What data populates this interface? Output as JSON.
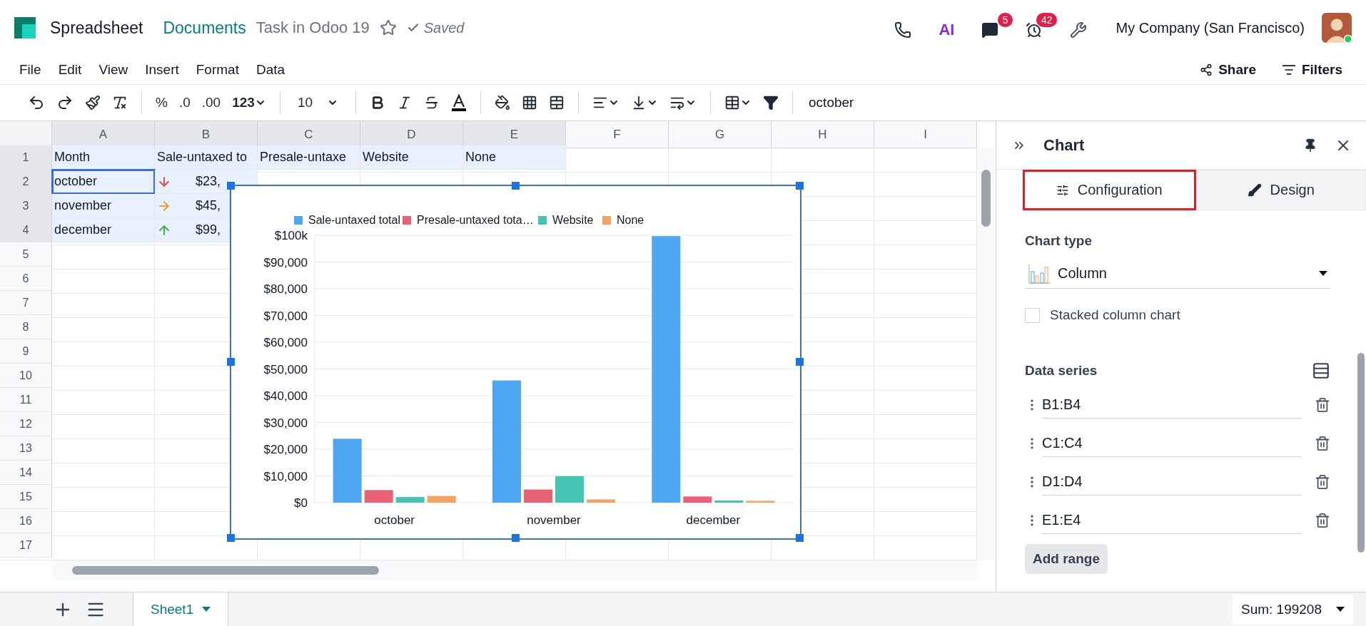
{
  "app": {
    "title": "Spreadsheet",
    "breadcrumb": "Documents",
    "record": "Task in Odoo 19",
    "status": "Saved"
  },
  "systray": {
    "ai": "AI",
    "chat_badge": "5",
    "activity_badge": "42",
    "company": "My Company (San Francisco)"
  },
  "menu": [
    "File",
    "Edit",
    "View",
    "Insert",
    "Format",
    "Data"
  ],
  "actions": [
    "Share",
    "Filters"
  ],
  "toolbar": {
    "formats": [
      "%",
      ".0",
      ".00",
      "123"
    ],
    "font_size": "10",
    "formula": "october"
  },
  "grid": {
    "columns": [
      {
        "label": "A",
        "selected": true
      },
      {
        "label": "B",
        "selected": true
      },
      {
        "label": "C",
        "selected": true
      },
      {
        "label": "D",
        "selected": true
      },
      {
        "label": "E",
        "selected": true
      },
      {
        "label": "F",
        "selected": false
      },
      {
        "label": "G",
        "selected": false
      },
      {
        "label": "H",
        "selected": false
      },
      {
        "label": "I",
        "selected": false
      }
    ],
    "rows": [
      {
        "label": "1",
        "selected": true,
        "cells": [
          {
            "text": "Month",
            "selected": true,
            "active": false
          },
          {
            "text": "Sale-untaxed to",
            "selected": true,
            "active": false
          },
          {
            "text": "Presale-untaxe",
            "selected": true,
            "active": false
          },
          {
            "text": "Website",
            "selected": true,
            "active": false
          },
          {
            "text": "None",
            "selected": true,
            "active": false
          }
        ]
      },
      {
        "label": "2",
        "selected": true,
        "cells": [
          {
            "text": "october",
            "selected": true,
            "active": true
          },
          {
            "text": "$23,",
            "kind": "down",
            "selected": true,
            "active": false
          }
        ]
      },
      {
        "label": "3",
        "selected": true,
        "cells": [
          {
            "text": "november",
            "selected": true,
            "active": false
          },
          {
            "text": "$45,",
            "kind": "flat",
            "selected": true,
            "active": false
          }
        ]
      },
      {
        "label": "4",
        "selected": true,
        "cells": [
          {
            "text": "december",
            "selected": true,
            "active": false
          },
          {
            "text": "$99,",
            "kind": "up",
            "selected": true,
            "active": false
          }
        ]
      },
      {
        "label": "5",
        "selected": false,
        "cells": []
      },
      {
        "label": "6",
        "selected": false,
        "cells": []
      },
      {
        "label": "7",
        "selected": false,
        "cells": []
      },
      {
        "label": "8",
        "selected": false,
        "cells": []
      },
      {
        "label": "9",
        "selected": false,
        "cells": []
      },
      {
        "label": "10",
        "selected": false,
        "cells": []
      },
      {
        "label": "11",
        "selected": false,
        "cells": []
      },
      {
        "label": "12",
        "selected": false,
        "cells": []
      },
      {
        "label": "13",
        "selected": false,
        "cells": []
      },
      {
        "label": "14",
        "selected": false,
        "cells": []
      },
      {
        "label": "15",
        "selected": false,
        "cells": []
      },
      {
        "label": "16",
        "selected": false,
        "cells": []
      },
      {
        "label": "17",
        "selected": false,
        "cells": []
      }
    ]
  },
  "chart": {
    "chart_data": {
      "type": "bar",
      "grid": true,
      "legend": "top",
      "categories": [
        "october",
        "november",
        "december"
      ],
      "series": [
        {
          "name": "Sale-untaxed total",
          "color": "#4ea7f2",
          "values": [
            23900,
            45700,
            99700
          ]
        },
        {
          "name": "Presale-untaxed tota…",
          "color": "#ea6175",
          "values": [
            4700,
            4900,
            2300
          ]
        },
        {
          "name": "Website",
          "color": "#43c5b1",
          "values": [
            2100,
            9900,
            800
          ]
        },
        {
          "name": "None",
          "color": "#f4a261",
          "values": [
            2500,
            1200,
            700
          ]
        }
      ],
      "ylim": [
        0,
        100000
      ],
      "yticks": [
        {
          "value": 0,
          "label": "$0"
        },
        {
          "value": 10000,
          "label": "$10,000"
        },
        {
          "value": 20000,
          "label": "$20,000"
        },
        {
          "value": 30000,
          "label": "$30,000"
        },
        {
          "value": 40000,
          "label": "$40,000"
        },
        {
          "value": 50000,
          "label": "$50,000"
        },
        {
          "value": 60000,
          "label": "$60,000"
        },
        {
          "value": 70000,
          "label": "$70,000"
        },
        {
          "value": 80000,
          "label": "$80,000"
        },
        {
          "value": 90000,
          "label": "$90,000"
        },
        {
          "value": 100000,
          "label": "$100k"
        }
      ]
    }
  },
  "panel": {
    "title": "Chart",
    "tabs": [
      {
        "label": "Configuration",
        "selected": true,
        "kind": "config"
      },
      {
        "label": "Design",
        "selected": false,
        "kind": "design"
      }
    ],
    "chart_type_label": "Chart type",
    "chart_type": "Column",
    "stacked": {
      "label": "Stacked column chart",
      "checked": false
    },
    "series_label": "Data series",
    "ranges": [
      "B1:B4",
      "C1:C4",
      "D1:D4",
      "E1:E4"
    ],
    "add_button": "Add range"
  },
  "sheets": [
    {
      "label": "Sheet1",
      "selected": true
    }
  ],
  "sum": "Sum: 199208"
}
